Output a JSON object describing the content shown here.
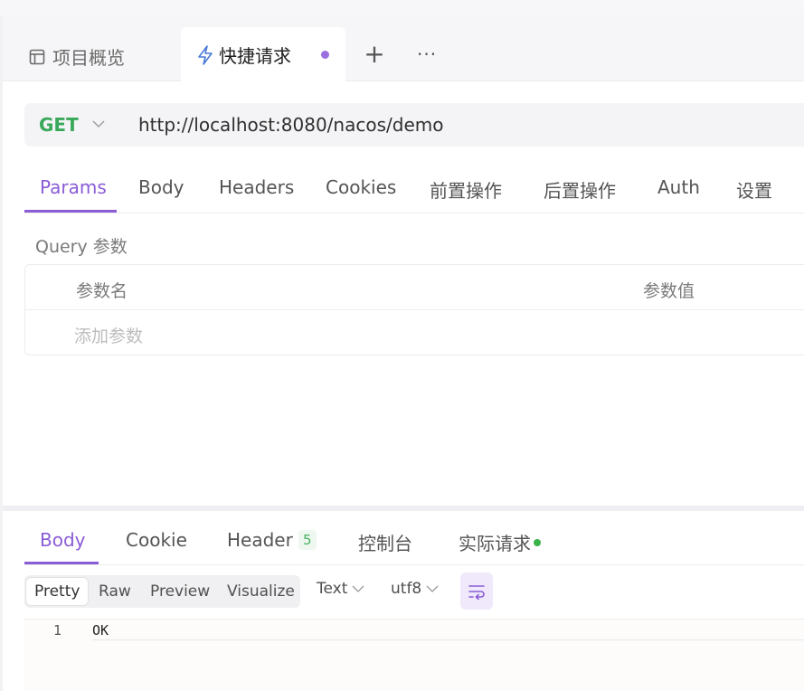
{
  "tabs": {
    "overview_label": "项目概览",
    "active_label": "快捷请求",
    "add_label": "+",
    "more_label": "···"
  },
  "request": {
    "method": "GET",
    "url": "http://localhost:8080/nacos/demo"
  },
  "request_tabs": [
    "Params",
    "Body",
    "Headers",
    "Cookies",
    "前置操作",
    "后置操作",
    "Auth",
    "设置"
  ],
  "params": {
    "section_title": "Query 参数",
    "col_name": "参数名",
    "col_value": "参数值",
    "add_placeholder": "添加参数"
  },
  "response_tabs": {
    "body": "Body",
    "cookie": "Cookie",
    "header": "Header",
    "header_count": "5",
    "console": "控制台",
    "actual_request": "实际请求"
  },
  "format": {
    "modes": [
      "Pretty",
      "Raw",
      "Preview",
      "Visualize"
    ],
    "type": "Text",
    "encoding": "utf8"
  },
  "response_body": {
    "line_number": "1",
    "text": "OK"
  },
  "colors": {
    "accent": "#8a5cd6",
    "method": "#3aa85a",
    "status_dot": "#3ab24a"
  }
}
